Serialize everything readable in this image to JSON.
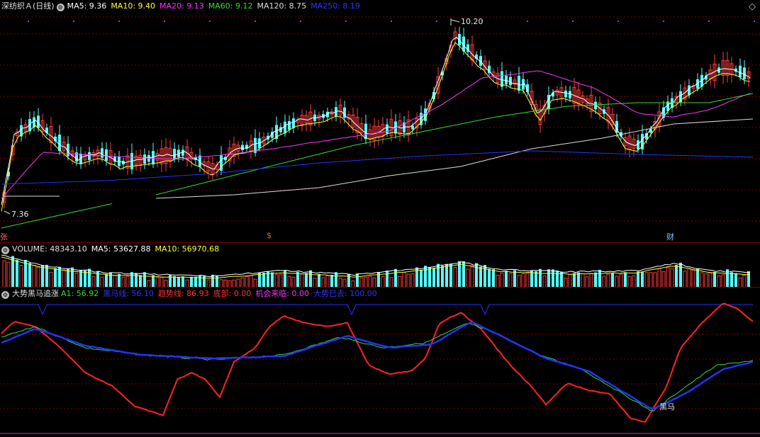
{
  "price_panel": {
    "title": "深纺织Ａ(日线)",
    "legend": [
      {
        "label": "MA5: 9.36",
        "color": "#ffffff"
      },
      {
        "label": "MA10: 9.40",
        "color": "#ffff33"
      },
      {
        "label": "MA20: 9.13",
        "color": "#ff33ff"
      },
      {
        "label": "MA60: 9.12",
        "color": "#33dd33"
      },
      {
        "label": "MA120: 8.75",
        "color": "#dddddd"
      },
      {
        "label": "MA250: 8.19",
        "color": "#3333ff"
      }
    ],
    "high_label": "10.20",
    "low_label": "7.36",
    "markers": {
      "zhang": "张",
      "s": "$",
      "cai": "财"
    },
    "corner_icon": "diamond-icon"
  },
  "volume_panel": {
    "legend": [
      {
        "label": "VOLUME: 48343.10",
        "color": "#e0e0e0"
      },
      {
        "label": "MA5: 53627.88",
        "color": "#ffffff"
      },
      {
        "label": "MA10: 56970.68",
        "color": "#ffff33"
      }
    ]
  },
  "indicator_panel": {
    "title": "大势黑马追涨",
    "legend": [
      {
        "label": "A1: 56.92",
        "color": "#33dd33"
      },
      {
        "label": "黑马线: 56.10",
        "color": "#3333ff"
      },
      {
        "label": "趋势线: 86.93",
        "color": "#ff3333"
      },
      {
        "label": "底部: 0.00",
        "color": "#ff3333"
      },
      {
        "label": "机会来临: 0.00",
        "color": "#ff33ff"
      },
      {
        "label": "大势已去: 100.00",
        "color": "#3333ff"
      }
    ],
    "signal_label": "黑马"
  },
  "colors": {
    "up": "#ff3b3b",
    "down": "#54ffff",
    "grid": "#7a0000",
    "ma5": "#ffffff",
    "ma10": "#ffff33",
    "ma20": "#ff33ff",
    "ma60": "#33dd33",
    "ma120": "#dddddd",
    "ma250": "#2233ff"
  }
}
